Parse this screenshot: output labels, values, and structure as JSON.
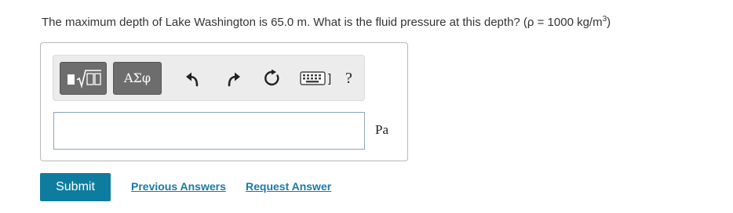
{
  "question": {
    "text": "The maximum depth of Lake Washington is 65.0 m. What is the fluid pressure at this depth? (ρ = 1000 kg/m",
    "superscript": "3",
    "closing": ")"
  },
  "toolbar": {
    "template_button_icon": "fraction-sqrt-template-icon",
    "symbols_label": "ΑΣφ",
    "undo_icon": "undo-arrow-icon",
    "redo_icon": "redo-arrow-icon",
    "reset_icon": "reset-circle-icon",
    "keyboard_icon": "keyboard-icon",
    "keyboard_suffix": "]",
    "help_label": "?"
  },
  "answer": {
    "value": "",
    "placeholder": "",
    "unit": "Pa"
  },
  "actions": {
    "submit_label": "Submit",
    "previous_answers_label": "Previous Answers",
    "request_answer_label": "Request Answer"
  },
  "colors": {
    "submit_bg": "#0e7c9e",
    "link": "#1a7aa6",
    "toolbar_button": "#6d6d6d"
  }
}
